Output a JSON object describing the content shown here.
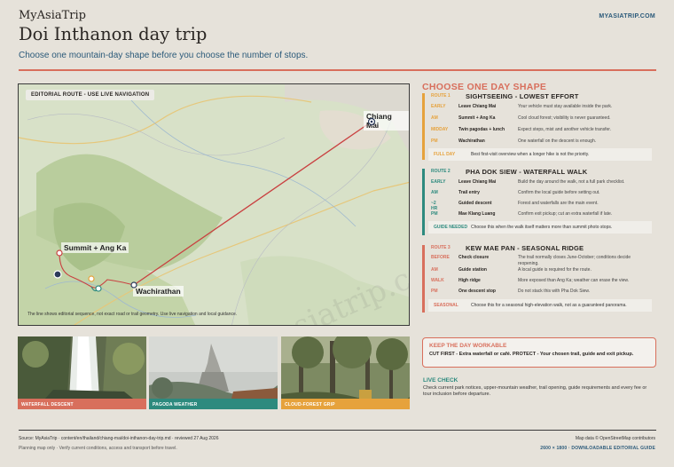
{
  "header": {
    "brand": "MyAsiaTrip",
    "site": "MYASIATRIP.COM",
    "title": "Doi Inthanon day trip",
    "subtitle": "Choose one mountain-day shape before you choose the number of stops."
  },
  "map": {
    "label": "EDITORIAL ROUTE - USE LIVE NAVIGATION",
    "places": [
      "Chiang Mai",
      "Summit + Ang Ka",
      "Wachirathan"
    ],
    "note": "The line shows editorial sequence, not exact road or trail geometry. Use live navigation and local guidance.",
    "watermark": "myasiatrip.com"
  },
  "panel": {
    "heading": "CHOOSE ONE DAY SHAPE",
    "routes": [
      {
        "tag": "ROUTE 1",
        "title": "SIGHTSEEING - LOWEST EFFORT",
        "color": "#e6a23c",
        "rows": [
          {
            "time": "EARLY",
            "what": "Leave Chiang Mai",
            "note": "Your vehicle must stay available inside the park."
          },
          {
            "time": "AM",
            "what": "Summit + Ang Ka",
            "note": "Cool cloud forest; visibility is never guaranteed."
          },
          {
            "time": "MIDDAY",
            "what": "Twin pagodas + lunch",
            "note": "Expect steps, mist and another vehicle transfer."
          },
          {
            "time": "PM",
            "what": "Wachirathan",
            "note": "One waterfall on the descent is enough."
          }
        ],
        "foot_key": "FULL DAY",
        "foot_val": "Best first-visit overview when a longer hike is not the priority."
      },
      {
        "tag": "ROUTE 2",
        "title": "PHA DOK SIEW - WATERFALL WALK",
        "color": "#2d8a7e",
        "rows": [
          {
            "time": "EARLY",
            "what": "Leave Chiang Mai",
            "note": "Build the day around the walk, not a full park checklist."
          },
          {
            "time": "AM",
            "what": "Trail entry",
            "note": "Confirm the local guide before setting out."
          },
          {
            "time": "~2 HR",
            "what": "Guided descent",
            "note": "Forest and waterfalls are the main event."
          },
          {
            "time": "PM",
            "what": "Mae Klang Luang",
            "note": "Confirm exit pickup; cut an extra waterfall if late."
          }
        ],
        "foot_key": "GUIDE NEEDED",
        "foot_val": "Choose this when the walk itself matters more than summit photo stops."
      },
      {
        "tag": "ROUTE 3",
        "title": "KEW MAE PAN - SEASONAL RIDGE",
        "color": "#d86f5c",
        "rows": [
          {
            "time": "BEFORE",
            "what": "Check closure",
            "note": "The trail normally closes June-October; conditions decide reopening."
          },
          {
            "time": "AM",
            "what": "Guide station",
            "note": "A local guide is required for the route."
          },
          {
            "time": "WALK",
            "what": "High ridge",
            "note": "More exposed than Ang Ka; weather can erase the view."
          },
          {
            "time": "PM",
            "what": "One descent stop",
            "note": "Do not stack this with Pha Dok Siew."
          }
        ],
        "foot_key": "SEASONAL",
        "foot_val": "Choose this for a seasonal high-elevation walk, not as a guaranteed panorama."
      }
    ]
  },
  "photos": [
    {
      "caption": "WATERFALL DESCENT",
      "color": "#d86f5c"
    },
    {
      "caption": "PAGODA WEATHER",
      "color": "#2d8a7e"
    },
    {
      "caption": "CLOUD-FOREST GRIP",
      "color": "#e6a23c"
    }
  ],
  "workable": {
    "heading": "KEEP THE DAY WORKABLE",
    "body": "CUT FIRST - Extra waterfall or café. PROTECT - Your chosen trail, guide and exit pickup."
  },
  "live": {
    "heading": "LIVE CHECK",
    "body": "Check current park notices, upper-mountain weather, trail opening, guide requirements and every fee or tour inclusion before departure."
  },
  "footer": {
    "source": "Source: MyAsiaTrip · content/en/thailand/chiang-mai/doi-inthanon-day-trip.md · reviewed 27 Aug 2026",
    "planning": "Planning map only · Verify current conditions, access and transport before travel.",
    "credit": "Map data © OpenStreetMap contributors",
    "format": "2600 × 1800 · DOWNLOADABLE EDITORIAL GUIDE"
  }
}
